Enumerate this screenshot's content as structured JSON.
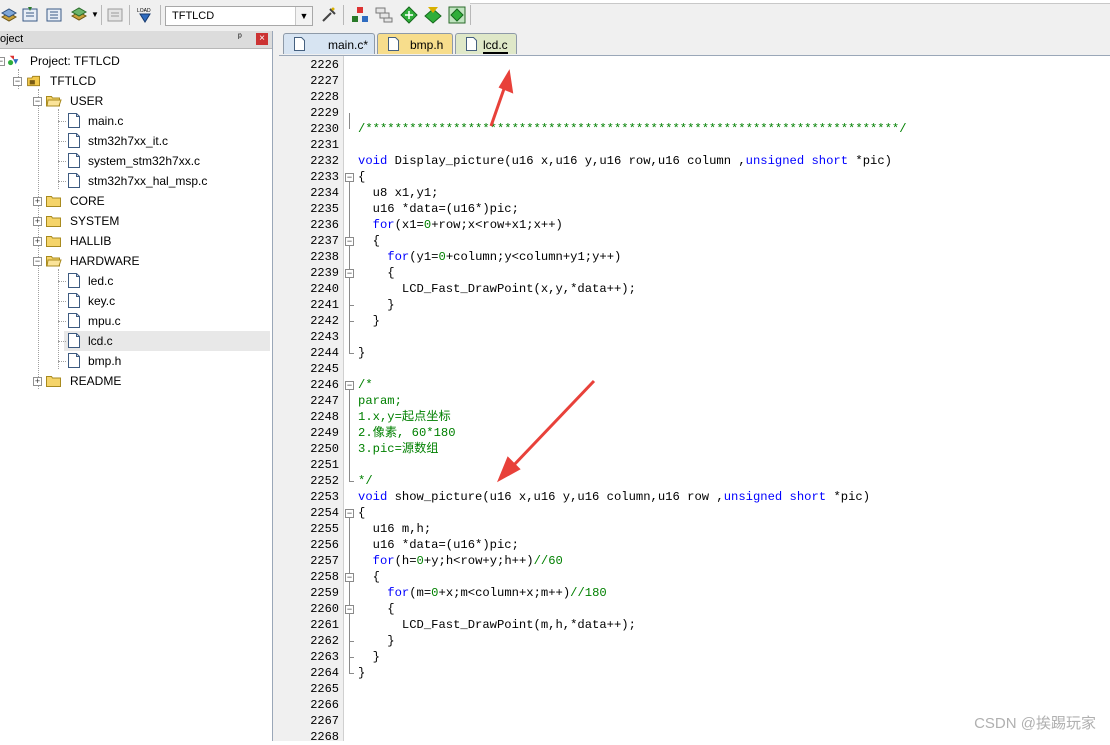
{
  "toolbar": {
    "target": "TFTLCD",
    "load_label": "LOAD"
  },
  "project_panel": {
    "title": "oject",
    "pin": "ᵖ",
    "close": "×",
    "tree": [
      {
        "label": "Project: TFTLCD",
        "level": 0,
        "kind": "project"
      },
      {
        "label": "TFTLCD",
        "level": 1,
        "kind": "target"
      },
      {
        "label": "USER",
        "level": 2,
        "kind": "folder-open"
      },
      {
        "label": "main.c",
        "level": 3,
        "kind": "file"
      },
      {
        "label": "stm32h7xx_it.c",
        "level": 3,
        "kind": "file"
      },
      {
        "label": "system_stm32h7xx.c",
        "level": 3,
        "kind": "file"
      },
      {
        "label": "stm32h7xx_hal_msp.c",
        "level": 3,
        "kind": "file"
      },
      {
        "label": "CORE",
        "level": 2,
        "kind": "folder"
      },
      {
        "label": "SYSTEM",
        "level": 2,
        "kind": "folder"
      },
      {
        "label": "HALLIB",
        "level": 2,
        "kind": "folder"
      },
      {
        "label": "HARDWARE",
        "level": 2,
        "kind": "folder-open"
      },
      {
        "label": "led.c",
        "level": 3,
        "kind": "file"
      },
      {
        "label": "key.c",
        "level": 3,
        "kind": "file"
      },
      {
        "label": "mpu.c",
        "level": 3,
        "kind": "file"
      },
      {
        "label": "lcd.c",
        "level": 3,
        "kind": "file",
        "selected": true
      },
      {
        "label": "bmp.h",
        "level": 3,
        "kind": "file"
      },
      {
        "label": "README",
        "level": 2,
        "kind": "folder"
      }
    ]
  },
  "tabs": [
    {
      "label": "main.c*",
      "active": false,
      "color": "#d7e4f2"
    },
    {
      "label": "bmp.h",
      "active": false,
      "color": "#f7dd8c"
    },
    {
      "label": "lcd.c",
      "active": true,
      "color": "#dfe8c8"
    }
  ],
  "editor": {
    "lines": [
      {
        "n": "2226",
        "s": []
      },
      {
        "n": "2227",
        "s": []
      },
      {
        "n": "2228",
        "s": []
      },
      {
        "n": "2229",
        "s": []
      },
      {
        "n": "2230",
        "s": [
          [
            "c",
            "/*************************************************************************/"
          ]
        ]
      },
      {
        "n": "2231",
        "s": []
      },
      {
        "n": "2232",
        "s": [
          [
            "k",
            "void"
          ],
          [
            "t",
            " Display_picture(u16 x,u16 y,u16 row,u16 column ,"
          ],
          [
            "k",
            "unsigned"
          ],
          [
            "t",
            " "
          ],
          [
            "k",
            "short"
          ],
          [
            "t",
            " *pic)"
          ]
        ]
      },
      {
        "n": "2233",
        "s": [
          [
            "t",
            "{"
          ]
        ]
      },
      {
        "n": "2234",
        "s": [
          [
            "t",
            "  u8 x1,y1;"
          ]
        ]
      },
      {
        "n": "2235",
        "s": [
          [
            "t",
            "  u16 *data=(u16*)pic;"
          ]
        ]
      },
      {
        "n": "2236",
        "s": [
          [
            "t",
            "  "
          ],
          [
            "k",
            "for"
          ],
          [
            "t",
            "(x1="
          ],
          [
            "n",
            "0"
          ],
          [
            "t",
            "+row;x<row+x1;x++)"
          ]
        ]
      },
      {
        "n": "2237",
        "s": [
          [
            "t",
            "  {"
          ]
        ]
      },
      {
        "n": "2238",
        "s": [
          [
            "t",
            "    "
          ],
          [
            "k",
            "for"
          ],
          [
            "t",
            "(y1="
          ],
          [
            "n",
            "0"
          ],
          [
            "t",
            "+column;y<column+y1;y++)"
          ]
        ]
      },
      {
        "n": "2239",
        "s": [
          [
            "t",
            "    {"
          ]
        ]
      },
      {
        "n": "2240",
        "s": [
          [
            "t",
            "      LCD_Fast_DrawPoint(x,y,*data++);"
          ]
        ]
      },
      {
        "n": "2241",
        "s": [
          [
            "t",
            "    }"
          ]
        ]
      },
      {
        "n": "2242",
        "s": [
          [
            "t",
            "  }"
          ]
        ]
      },
      {
        "n": "2243",
        "s": []
      },
      {
        "n": "2244",
        "s": [
          [
            "t",
            "}"
          ]
        ]
      },
      {
        "n": "2245",
        "s": []
      },
      {
        "n": "2246",
        "s": [
          [
            "c",
            "/*"
          ]
        ]
      },
      {
        "n": "2247",
        "s": [
          [
            "c",
            "param;"
          ]
        ]
      },
      {
        "n": "2248",
        "s": [
          [
            "c",
            "1.x,y=起点坐标"
          ]
        ]
      },
      {
        "n": "2249",
        "s": [
          [
            "c",
            "2.像素, 60*180"
          ]
        ]
      },
      {
        "n": "2250",
        "s": [
          [
            "c",
            "3.pic=源数组"
          ]
        ]
      },
      {
        "n": "2251",
        "s": []
      },
      {
        "n": "2252",
        "s": [
          [
            "c",
            "*/"
          ]
        ]
      },
      {
        "n": "2253",
        "s": [
          [
            "k",
            "void"
          ],
          [
            "t",
            " show_picture(u16 x,u16 y,u16 column,u16 row ,"
          ],
          [
            "k",
            "unsigned"
          ],
          [
            "t",
            " "
          ],
          [
            "k",
            "short"
          ],
          [
            "t",
            " *pic)"
          ]
        ]
      },
      {
        "n": "2254",
        "s": [
          [
            "t",
            "{"
          ]
        ]
      },
      {
        "n": "2255",
        "s": [
          [
            "t",
            "  u16 m,h;"
          ]
        ]
      },
      {
        "n": "2256",
        "s": [
          [
            "t",
            "  u16 *data=(u16*)pic;"
          ]
        ]
      },
      {
        "n": "2257",
        "s": [
          [
            "t",
            "  "
          ],
          [
            "k",
            "for"
          ],
          [
            "t",
            "(h="
          ],
          [
            "n",
            "0"
          ],
          [
            "t",
            "+y;h<row+y;h++)"
          ],
          [
            "c",
            "//60"
          ]
        ]
      },
      {
        "n": "2258",
        "s": [
          [
            "t",
            "  {"
          ]
        ]
      },
      {
        "n": "2259",
        "s": [
          [
            "t",
            "    "
          ],
          [
            "k",
            "for"
          ],
          [
            "t",
            "(m="
          ],
          [
            "n",
            "0"
          ],
          [
            "t",
            "+x;m<column+x;m++)"
          ],
          [
            "c",
            "//180"
          ]
        ]
      },
      {
        "n": "2260",
        "s": [
          [
            "t",
            "    {"
          ]
        ]
      },
      {
        "n": "2261",
        "s": [
          [
            "t",
            "      LCD_Fast_DrawPoint(m,h,*data++);"
          ]
        ]
      },
      {
        "n": "2262",
        "s": [
          [
            "t",
            "    }"
          ]
        ]
      },
      {
        "n": "2263",
        "s": [
          [
            "t",
            "  }"
          ]
        ]
      },
      {
        "n": "2264",
        "s": [
          [
            "t",
            "}"
          ]
        ]
      },
      {
        "n": "2265",
        "s": []
      },
      {
        "n": "2266",
        "s": []
      },
      {
        "n": "2267",
        "s": []
      },
      {
        "n": "2268",
        "s": []
      }
    ]
  },
  "colors": {
    "keyword": "#0000ff",
    "comment": "#008000",
    "arrow": "#e8413a"
  },
  "watermark": "CSDN @挨踢玩家"
}
